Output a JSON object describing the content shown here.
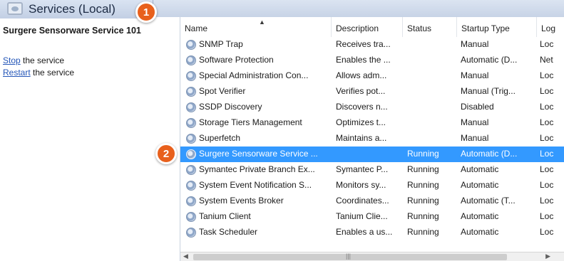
{
  "header": {
    "title": "Services (Local)"
  },
  "badges": {
    "one": "1",
    "two": "2"
  },
  "left_panel": {
    "service_name": "Surgere Sensorware Service 101",
    "stop_link": "Stop",
    "stop_rest": " the service",
    "restart_link": "Restart",
    "restart_rest": " the service"
  },
  "columns": {
    "name": "Name",
    "description": "Description",
    "status": "Status",
    "startup": "Startup Type",
    "log": "Log"
  },
  "rows": [
    {
      "name": "SNMP Trap",
      "description": "Receives tra...",
      "status": "",
      "startup": "Manual",
      "log": "Loc"
    },
    {
      "name": "Software Protection",
      "description": "Enables the ...",
      "status": "",
      "startup": "Automatic (D...",
      "log": "Net"
    },
    {
      "name": "Special Administration Con...",
      "description": "Allows adm...",
      "status": "",
      "startup": "Manual",
      "log": "Loc"
    },
    {
      "name": "Spot Verifier",
      "description": "Verifies pot...",
      "status": "",
      "startup": "Manual (Trig...",
      "log": "Loc"
    },
    {
      "name": "SSDP Discovery",
      "description": "Discovers n...",
      "status": "",
      "startup": "Disabled",
      "log": "Loc"
    },
    {
      "name": "Storage Tiers Management",
      "description": "Optimizes t...",
      "status": "",
      "startup": "Manual",
      "log": "Loc"
    },
    {
      "name": "Superfetch",
      "description": "Maintains a...",
      "status": "",
      "startup": "Manual",
      "log": "Loc"
    },
    {
      "name": "Surgere Sensorware Service ...",
      "description": "",
      "status": "Running",
      "startup": "Automatic (D...",
      "log": "Loc"
    },
    {
      "name": "Symantec Private Branch Ex...",
      "description": "Symantec P...",
      "status": "Running",
      "startup": "Automatic",
      "log": "Loc"
    },
    {
      "name": "System Event Notification S...",
      "description": "Monitors sy...",
      "status": "Running",
      "startup": "Automatic",
      "log": "Loc"
    },
    {
      "name": "System Events Broker",
      "description": "Coordinates...",
      "status": "Running",
      "startup": "Automatic (T...",
      "log": "Loc"
    },
    {
      "name": "Tanium Client",
      "description": "Tanium Clie...",
      "status": "Running",
      "startup": "Automatic",
      "log": "Loc"
    },
    {
      "name": "Task Scheduler",
      "description": "Enables a us...",
      "status": "Running",
      "startup": "Automatic",
      "log": "Loc"
    }
  ],
  "selected_row_index": 7,
  "colors": {
    "selection": "#3399ff",
    "badge": "#e8601c",
    "link": "#2456b8"
  },
  "icons": {
    "service": "gear-icon",
    "header": "services-icon"
  }
}
